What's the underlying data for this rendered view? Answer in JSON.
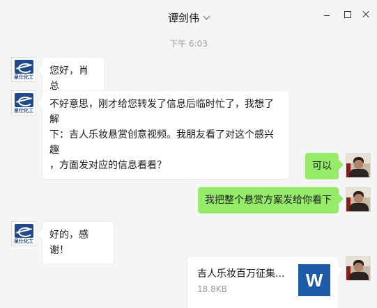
{
  "window": {
    "title": "谭剑伟",
    "controls": {
      "minimize_icon": "minimize-icon",
      "maximize_icon": "maximize-icon",
      "close_icon": "close-icon"
    }
  },
  "chat": {
    "timestamp": "下午 6:03",
    "contact_avatar_text": "泉仕化工",
    "messages": [
      {
        "sender": "contact",
        "type": "text",
        "text": "您好，肖总"
      },
      {
        "sender": "contact",
        "type": "text",
        "lines": [
          "不好意思，刚才给您转发了信息后临时忙了，我想了解",
          "下：吉人乐妆悬赏创意视频。我朋友看了对这个感兴趣",
          "，方面发对应的信息看看？"
        ]
      },
      {
        "sender": "me",
        "type": "text",
        "text": "可以"
      },
      {
        "sender": "me",
        "type": "text",
        "text": "我把整个悬赏方案发给你看下"
      },
      {
        "sender": "contact",
        "type": "text",
        "text": "好的，感谢！"
      },
      {
        "sender": "me",
        "type": "file",
        "file_name": "吉人乐妆百万征集...",
        "file_size": "18.8KB",
        "file_icon_letter": "W"
      }
    ]
  },
  "colors": {
    "sent_bubble": "#95ec69",
    "received_bubble": "#ffffff",
    "background": "#f5f5f5",
    "word_icon": "#1d5aa8"
  }
}
